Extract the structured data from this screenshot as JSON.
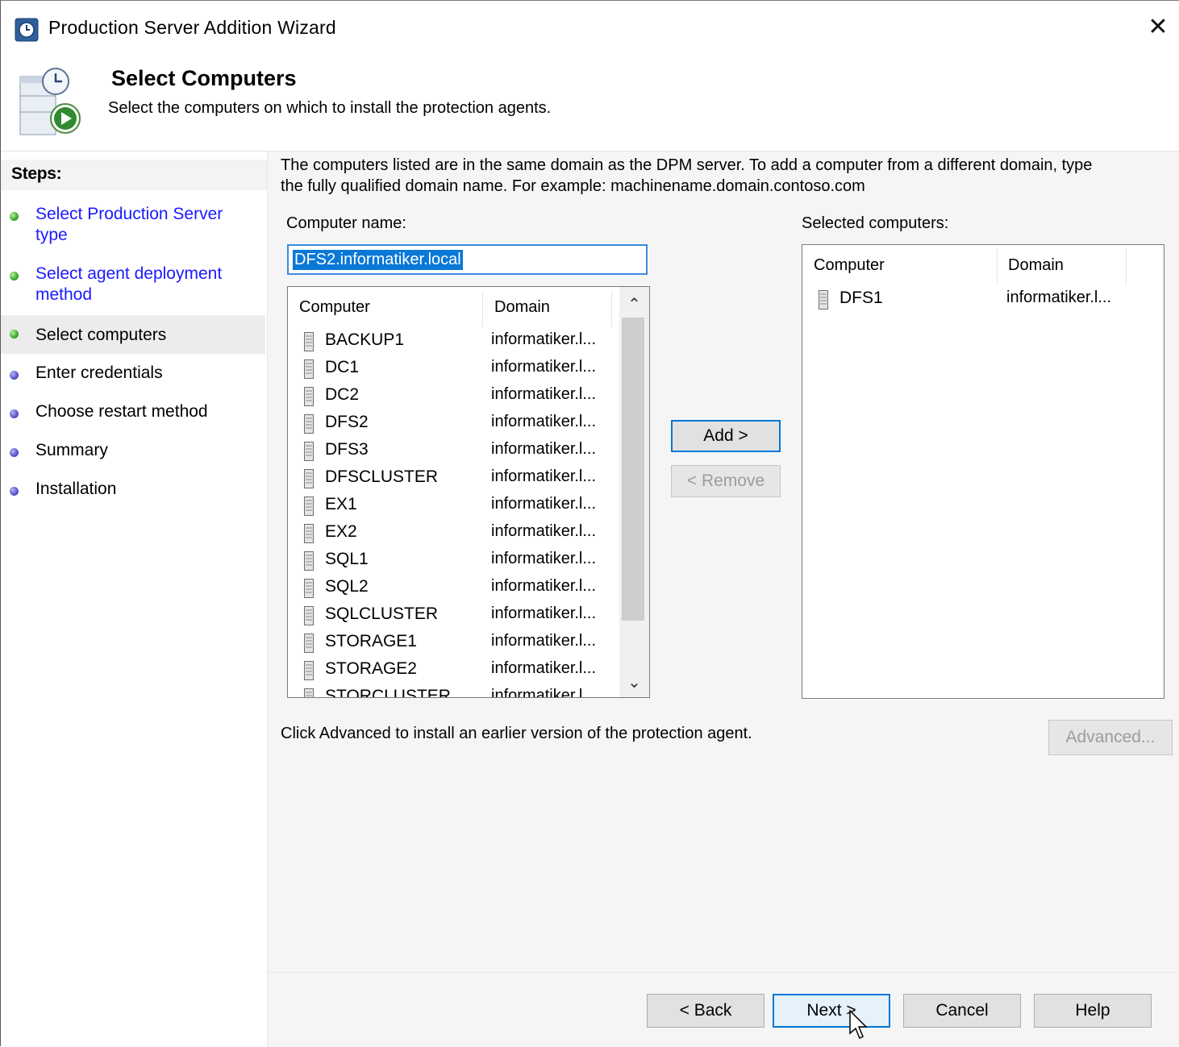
{
  "window": {
    "title": "Production Server Addition Wizard",
    "close_label": "✕"
  },
  "header": {
    "title": "Select Computers",
    "subtitle": "Select the computers on which to install the protection agents."
  },
  "steps": {
    "title": "Steps:",
    "items": [
      {
        "label": "Select Production Server type",
        "state": "done",
        "link": true
      },
      {
        "label": "Select agent deployment method",
        "state": "done",
        "link": true
      },
      {
        "label": "Select computers",
        "state": "current",
        "link": false
      },
      {
        "label": "Enter credentials",
        "state": "pending",
        "link": false
      },
      {
        "label": "Choose restart method",
        "state": "pending",
        "link": false
      },
      {
        "label": "Summary",
        "state": "pending",
        "link": false
      },
      {
        "label": "Installation",
        "state": "pending",
        "link": false
      }
    ]
  },
  "main": {
    "description": "The computers listed are in the same domain as the DPM server. To add a computer from a different domain, type the fully qualified domain name. For example: machinename.domain.contoso.com",
    "computer_name_label": "Computer name:",
    "computer_name_value": "DFS2.informatiker.local",
    "selected_label": "Selected computers:",
    "list_columns": [
      "Computer",
      "Domain"
    ],
    "computers": [
      {
        "name": "BACKUP1",
        "domain": "informatiker.l..."
      },
      {
        "name": "DC1",
        "domain": "informatiker.l..."
      },
      {
        "name": "DC2",
        "domain": "informatiker.l..."
      },
      {
        "name": "DFS2",
        "domain": "informatiker.l..."
      },
      {
        "name": "DFS3",
        "domain": "informatiker.l..."
      },
      {
        "name": "DFSCLUSTER",
        "domain": "informatiker.l..."
      },
      {
        "name": "EX1",
        "domain": "informatiker.l..."
      },
      {
        "name": "EX2",
        "domain": "informatiker.l..."
      },
      {
        "name": "SQL1",
        "domain": "informatiker.l..."
      },
      {
        "name": "SQL2",
        "domain": "informatiker.l..."
      },
      {
        "name": "SQLCLUSTER",
        "domain": "informatiker.l..."
      },
      {
        "name": "STORAGE1",
        "domain": "informatiker.l..."
      },
      {
        "name": "STORAGE2",
        "domain": "informatiker.l..."
      },
      {
        "name": "STORCLUSTER",
        "domain": "informatiker.l..."
      }
    ],
    "selected_columns": [
      "Computer",
      "Domain"
    ],
    "selected": [
      {
        "name": "DFS1",
        "domain": "informatiker.l..."
      }
    ],
    "add_button": "Add >",
    "remove_button": "< Remove",
    "advanced_text": "Click Advanced to install an earlier version of the protection agent.",
    "advanced_button": "Advanced..."
  },
  "footer": {
    "back": "< Back",
    "next": "Next >",
    "cancel": "Cancel",
    "help": "Help"
  }
}
